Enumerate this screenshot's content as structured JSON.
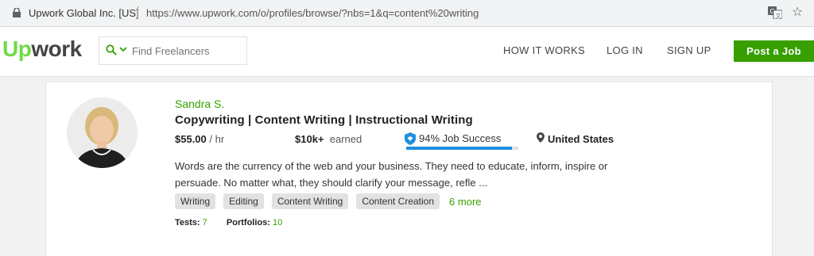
{
  "browser": {
    "site_identity": "Upwork Global Inc. [US]",
    "url": "https://www.upwork.com/o/profiles/browse/?nbs=1&q=content%20writing"
  },
  "header": {
    "logo_up": "Up",
    "logo_work": "work",
    "search_placeholder": "Find Freelancers",
    "nav": {
      "how_it_works": "HOW IT WORKS",
      "log_in": "LOG IN",
      "sign_up": "SIGN UP"
    },
    "post_job_label": "Post a Job"
  },
  "profile": {
    "name": "Sandra S.",
    "title": "Copywriting | Content Writing | Instructional Writing",
    "rate_value": "$55.00",
    "rate_unit": "/ hr",
    "earned_value": "$10k+",
    "earned_label": "earned",
    "job_success_text": "94% Job Success",
    "job_success_percent": 94,
    "country": "United States",
    "description": "Words are the currency of the web and your business. They need to educate, inform, inspire or persuade. No matter what, they should clarify your message, refle ...",
    "skills": [
      "Writing",
      "Editing",
      "Content Writing",
      "Content Creation"
    ],
    "more_skills": "6 more",
    "tests_label": "Tests:",
    "tests_value": "7",
    "portfolios_label": "Portfolios:",
    "portfolios_value": "10"
  },
  "colors": {
    "brand_green": "#37a000",
    "logo_green": "#6fda44",
    "job_success_blue": "#1d8fe0"
  }
}
